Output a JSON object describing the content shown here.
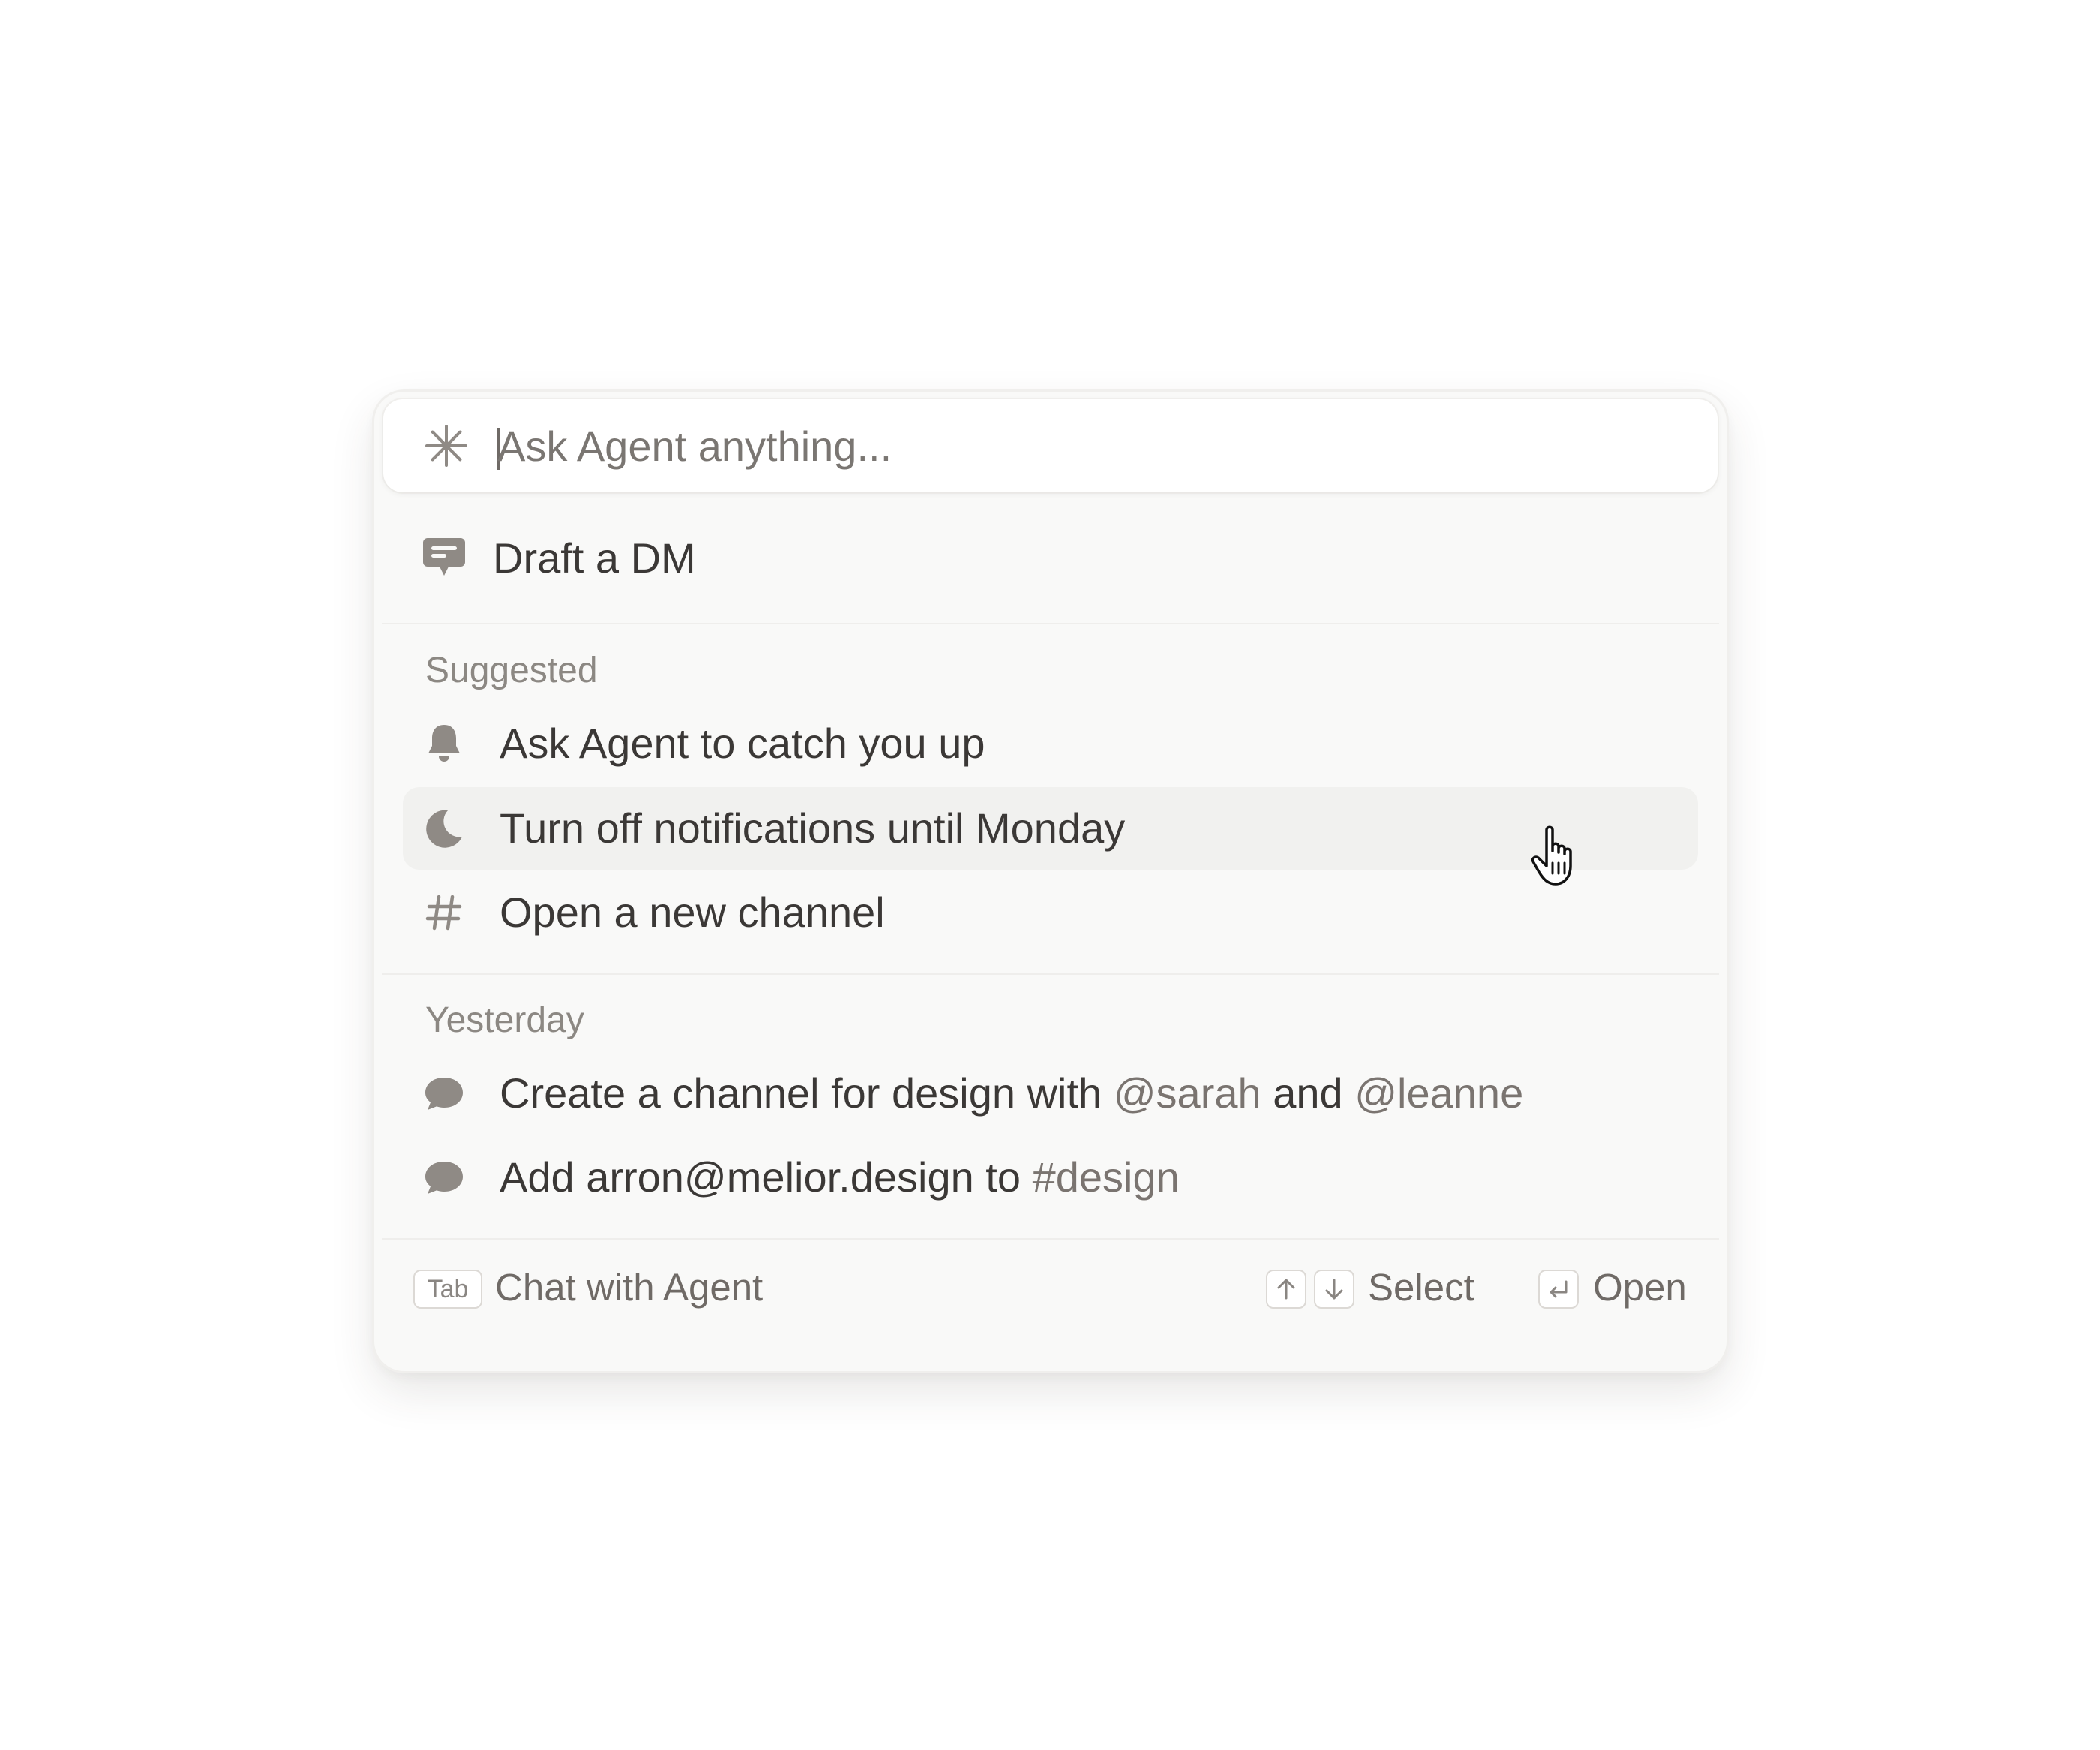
{
  "search": {
    "placeholder": "Ask Agent anything...",
    "value": ""
  },
  "primary_action": {
    "icon": "chat-square-icon",
    "label": "Draft a DM"
  },
  "suggested": {
    "title": "Suggested",
    "items": [
      {
        "icon": "bell-icon",
        "label": "Ask Agent to catch you up"
      },
      {
        "icon": "moon-icon",
        "label": "Turn off notifications until Monday",
        "hovered": true
      },
      {
        "icon": "hash-icon",
        "label": "Open a new channel"
      }
    ]
  },
  "yesterday": {
    "title": "Yesterday",
    "items": [
      {
        "icon": "speech-bubble-icon",
        "text_1": "Create a channel for design with ",
        "mention_1": "@sarah",
        "text_2": " and ",
        "mention_2": "@leanne"
      },
      {
        "icon": "speech-bubble-icon",
        "text_1": "Add arron@melior.design to ",
        "channel": "#design"
      }
    ]
  },
  "footer": {
    "tab_key": "Tab",
    "chat_label": "Chat with Agent",
    "select_label": "Select",
    "open_label": "Open"
  },
  "colors": {
    "panel_bg": "#f9f9f8",
    "hover_bg": "#f1f1ef",
    "text_primary": "#3b3836",
    "text_muted": "#7a7470",
    "icon_gray": "#8f8a85"
  }
}
